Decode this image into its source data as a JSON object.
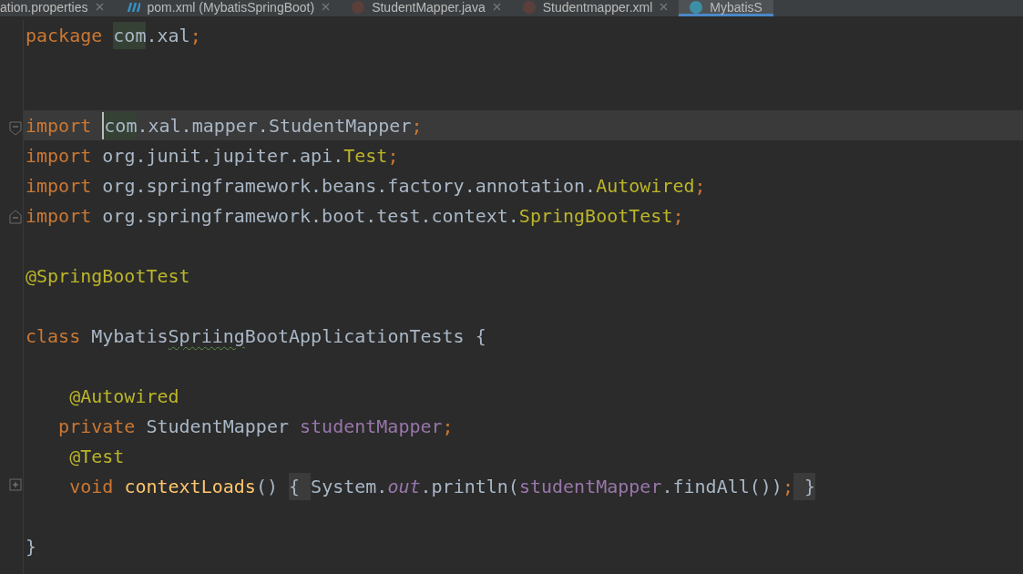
{
  "tabs": [
    {
      "label": "ation.properties",
      "kind": "plain",
      "selected": false
    },
    {
      "label": "pom.xml (MybatisSpringBoot)",
      "kind": "maven",
      "selected": false
    },
    {
      "label": "StudentMapper.java",
      "kind": "avatar",
      "selected": false
    },
    {
      "label": "Studentmapper.xml",
      "kind": "avatar",
      "selected": false
    },
    {
      "label": "MybatisS",
      "kind": "class",
      "selected": true
    }
  ],
  "lines": [
    {
      "current": false,
      "kind": "plain",
      "tokens": [
        {
          "kind": "keyword",
          "text": "package "
        },
        {
          "kind": "usage",
          "text": "com"
        },
        {
          "kind": "plain",
          "text": ".xal"
        },
        {
          "kind": "punct",
          "text": ";"
        }
      ]
    },
    {
      "current": false,
      "kind": "plain"
    },
    {
      "current": false,
      "kind": "plain"
    },
    {
      "current": true,
      "kind": "foldstart",
      "tokens": [
        {
          "kind": "keyword",
          "text": "import "
        },
        {
          "kind": "usage",
          "text": "com",
          "caret": true
        },
        {
          "kind": "plain",
          "text": ".xal.mapper.StudentMapper"
        },
        {
          "kind": "punct",
          "text": ";"
        }
      ]
    },
    {
      "current": false,
      "kind": "plain",
      "tokens": [
        {
          "kind": "keyword",
          "text": "import "
        },
        {
          "kind": "plain",
          "text": "org.junit.jupiter.api."
        },
        {
          "kind": "annotation",
          "text": "Test"
        },
        {
          "kind": "punct",
          "text": ";"
        }
      ]
    },
    {
      "current": false,
      "kind": "plain",
      "tokens": [
        {
          "kind": "keyword",
          "text": "import "
        },
        {
          "kind": "plain",
          "text": "org.springframework.beans.factory.annotation."
        },
        {
          "kind": "annotation",
          "text": "Autowired"
        },
        {
          "kind": "punct",
          "text": ";"
        }
      ]
    },
    {
      "current": false,
      "kind": "foldend",
      "tokens": [
        {
          "kind": "keyword",
          "text": "import "
        },
        {
          "kind": "plain",
          "text": "org.springframework.boot.test.context."
        },
        {
          "kind": "annotation",
          "text": "SpringBootTest"
        },
        {
          "kind": "punct",
          "text": ";"
        }
      ]
    },
    {
      "current": false,
      "kind": "plain"
    },
    {
      "current": false,
      "kind": "plain",
      "tokens": [
        {
          "kind": "annotation",
          "text": "@SpringBootTest"
        }
      ]
    },
    {
      "current": false,
      "kind": "plain"
    },
    {
      "current": false,
      "kind": "plain",
      "tokens": [
        {
          "kind": "keyword",
          "text": "class "
        },
        {
          "kind": "plain",
          "text": "Mybatis"
        },
        {
          "kind": "typo",
          "text": "Spriing"
        },
        {
          "kind": "plain",
          "text": "BootApplicationTests {"
        }
      ]
    },
    {
      "current": false,
      "kind": "plain"
    },
    {
      "current": false,
      "kind": "plain",
      "tokens": [
        {
          "kind": "annotation",
          "text": "    @Autowired"
        }
      ]
    },
    {
      "current": false,
      "kind": "plain",
      "tokens": [
        {
          "kind": "keyword",
          "text": "   private "
        },
        {
          "kind": "plain",
          "text": "StudentMapper "
        },
        {
          "kind": "field",
          "text": "studentMapper"
        },
        {
          "kind": "punct",
          "text": ";"
        }
      ]
    },
    {
      "current": false,
      "kind": "plain",
      "tokens": [
        {
          "kind": "annotation",
          "text": "    @Test"
        }
      ]
    },
    {
      "current": false,
      "kind": "collapsed",
      "tokens": [
        {
          "kind": "keyword",
          "text": "    void "
        },
        {
          "kind": "method",
          "text": "contextLoads"
        },
        {
          "kind": "plain",
          "text": "() "
        },
        {
          "kind": "folded",
          "text": "{ "
        },
        {
          "kind": "plain",
          "text": "System."
        },
        {
          "kind": "static",
          "text": "out"
        },
        {
          "kind": "plain",
          "text": ".println("
        },
        {
          "kind": "field",
          "text": "studentMapper"
        },
        {
          "kind": "plain",
          "text": ".findAll())"
        },
        {
          "kind": "punct",
          "text": ";"
        },
        {
          "kind": "folded",
          "text": " }"
        }
      ]
    },
    {
      "current": false,
      "kind": "plain"
    },
    {
      "current": false,
      "kind": "plain",
      "tokens": [
        {
          "kind": "plain",
          "text": "}"
        }
      ]
    }
  ]
}
